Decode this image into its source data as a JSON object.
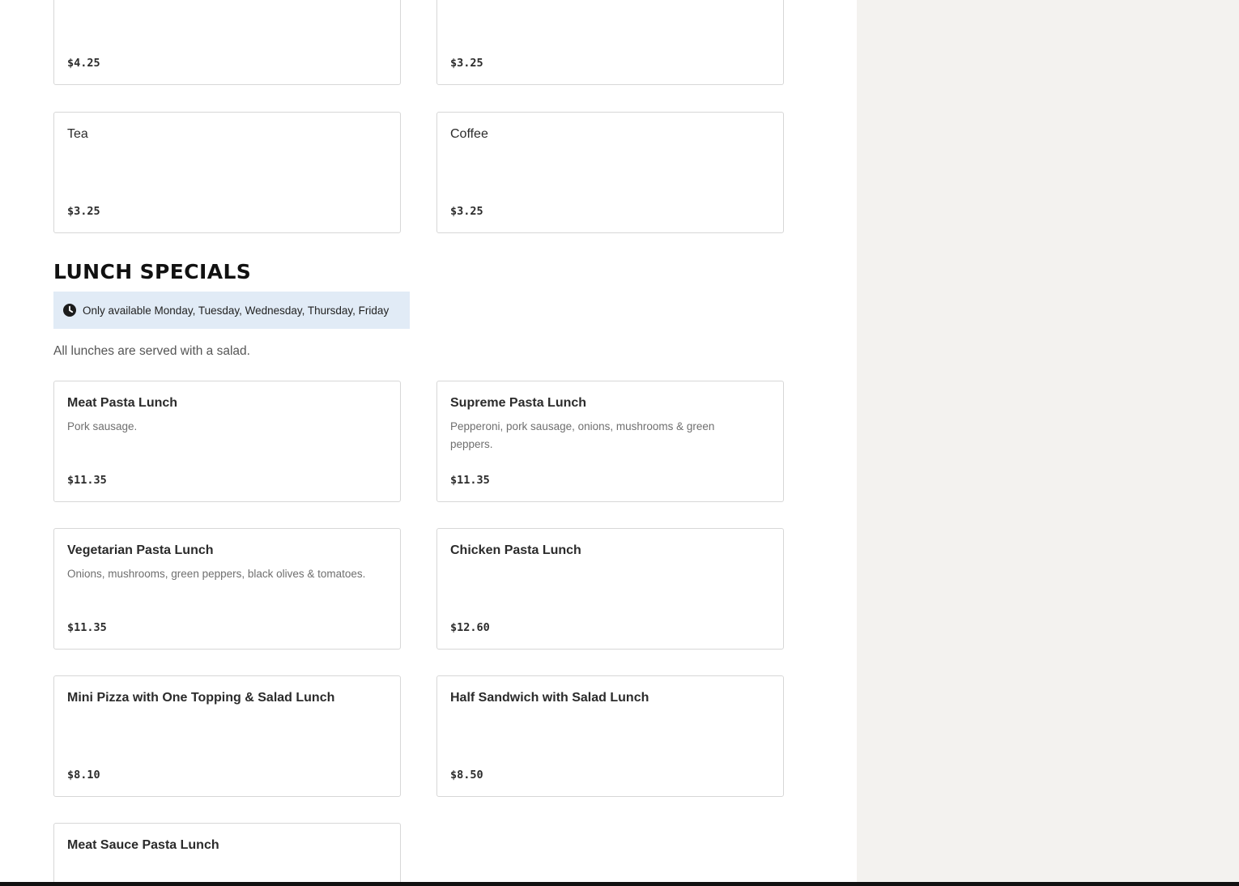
{
  "previous_section": {
    "items": [
      {
        "name": "",
        "description": "",
        "price": "$4.25"
      },
      {
        "name": "",
        "description": "",
        "price": "$3.25"
      },
      {
        "name": "Tea",
        "description": "",
        "price": "$3.25"
      },
      {
        "name": "Coffee",
        "description": "",
        "price": "$3.25"
      }
    ]
  },
  "lunch_specials": {
    "title": "LUNCH SPECIALS",
    "availability": "Only available Monday, Tuesday, Wednesday, Thursday, Friday",
    "availability_icon": "clock-icon",
    "note": "All lunches are served with a salad.",
    "items": [
      {
        "name": "Meat Pasta Lunch",
        "description": "Pork sausage.",
        "price": "$11.35"
      },
      {
        "name": "Supreme Pasta Lunch",
        "description": "Pepperoni, pork sausage, onions, mushrooms & green peppers.",
        "price": "$11.35"
      },
      {
        "name": "Vegetarian Pasta Lunch",
        "description": "Onions, mushrooms, green peppers, black olives & tomatoes.",
        "price": "$11.35"
      },
      {
        "name": "Chicken Pasta Lunch",
        "description": "",
        "price": "$12.60"
      },
      {
        "name": "Mini Pizza with One Topping & Salad Lunch",
        "description": "",
        "price": "$8.10"
      },
      {
        "name": "Half Sandwich with Salad Lunch",
        "description": "",
        "price": "$8.50"
      },
      {
        "name": "Meat Sauce Pasta Lunch",
        "description": "",
        "price": ""
      }
    ]
  },
  "colors": {
    "page_background": "#ffffff",
    "sidebar_background": "#f3f2ef",
    "availability_background": "#e1ebf6",
    "card_border": "#d7d7d7",
    "bottom_bar": "#111111"
  }
}
